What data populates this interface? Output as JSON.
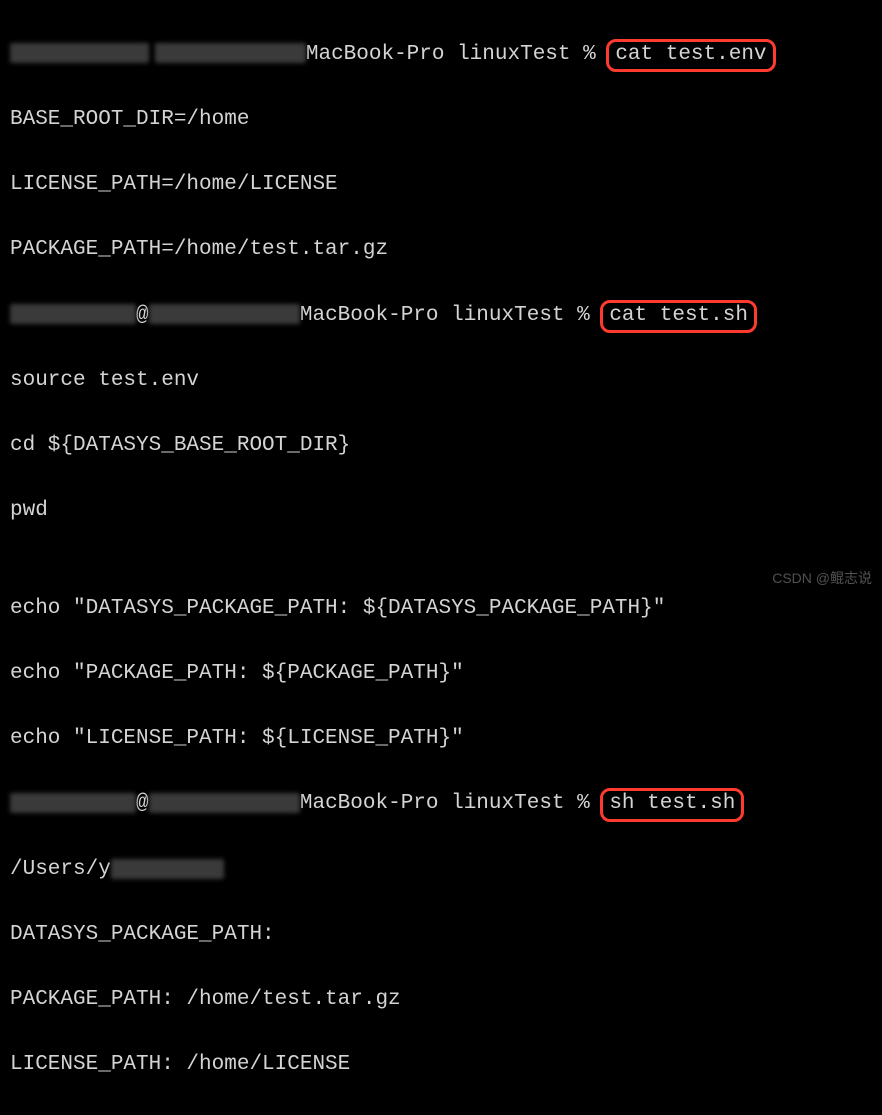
{
  "prompt_host_1": "MacBook-Pro linuxTest % ",
  "cmd_1": "cat test.env",
  "env_line_1": "BASE_ROOT_DIR=/home",
  "env_line_2": "LICENSE_PATH=/home/LICENSE",
  "env_line_3": "PACKAGE_PATH=/home/test.tar.gz",
  "prompt_at_1": "@",
  "prompt_host_2": "MacBook-Pro linuxTest % ",
  "cmd_2": "cat test.sh",
  "sh_line_1": "source test.env",
  "sh_line_2": "cd ${DATASYS_BASE_ROOT_DIR}",
  "sh_line_3": "pwd",
  "sh_blank": "",
  "sh_line_4": "echo \"DATASYS_PACKAGE_PATH: ${DATASYS_PACKAGE_PATH}\"",
  "sh_line_5": "echo \"PACKAGE_PATH: ${PACKAGE_PATH}\"",
  "sh_line_6": "echo \"LICENSE_PATH: ${LICENSE_PATH}\"",
  "prompt_at_2": "@",
  "prompt_host_3": "MacBook-Pro linuxTest % ",
  "cmd_3": "sh test.sh",
  "out_line_1_prefix": "/Users/y",
  "out_line_2": "DATASYS_PACKAGE_PATH:",
  "out_line_3": "PACKAGE_PATH: /home/test.tar.gz",
  "out_line_4": "LICENSE_PATH: /home/LICENSE",
  "watermark": "CSDN @鲲志说"
}
